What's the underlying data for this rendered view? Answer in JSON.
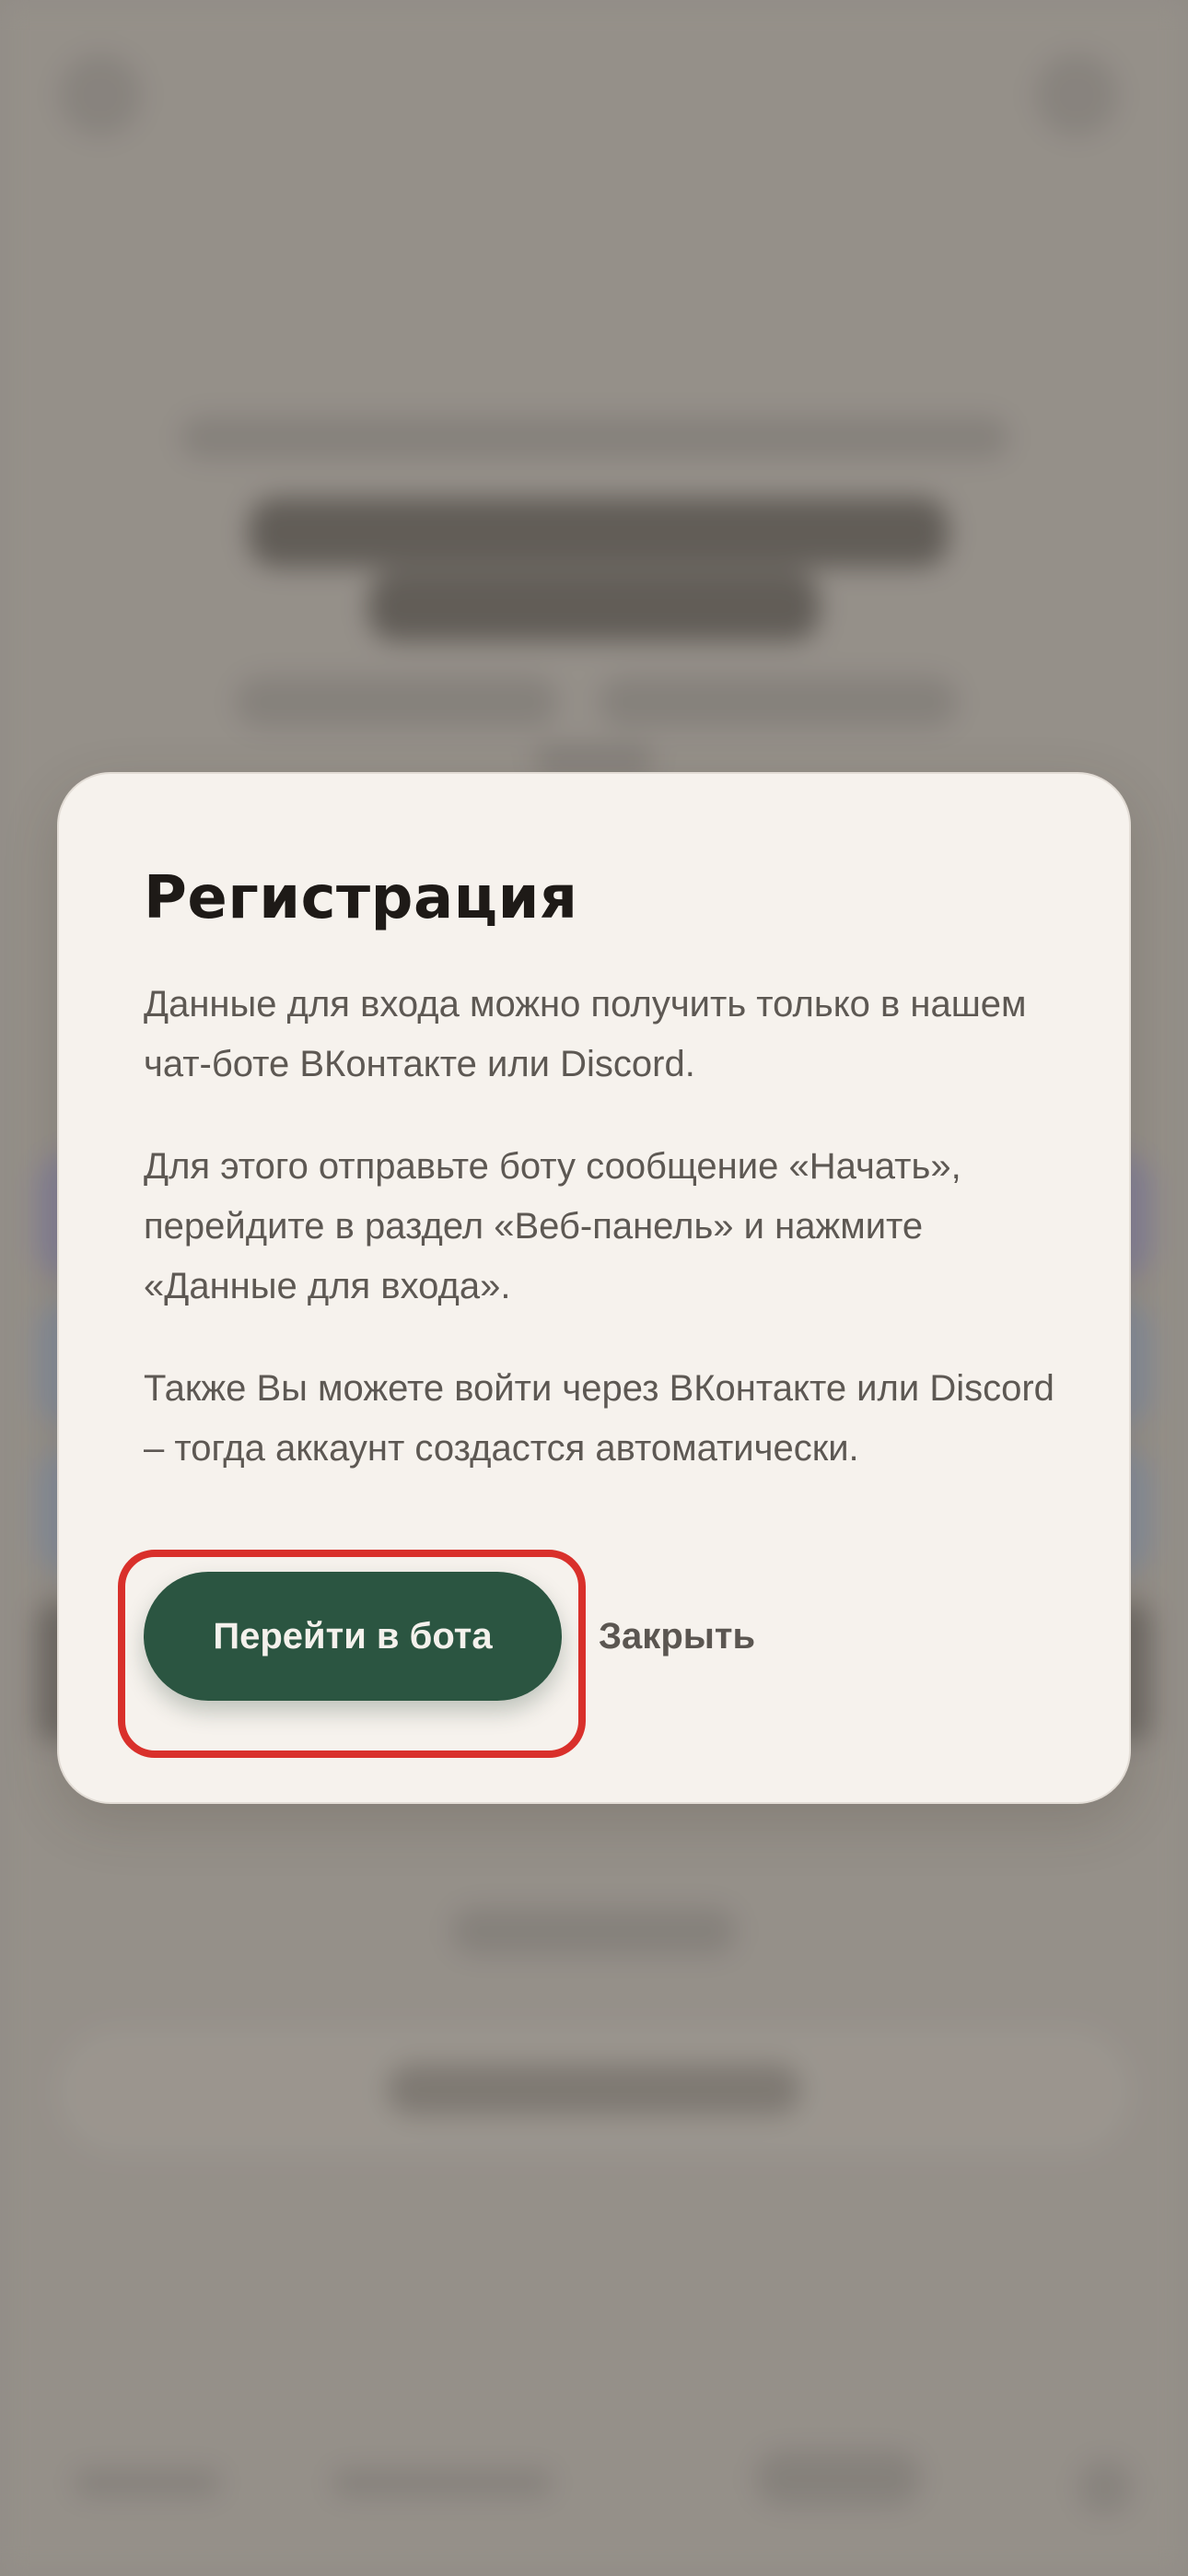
{
  "dialog": {
    "title": "Регистрация",
    "paragraphs": [
      "Данные для входа можно получить только в нашем чат-боте ВКонтакте или Discord.",
      "Для этого отправьте боту сообщение «Начать», перейдите в раздел «Веб-панель» и нажмите «Данные для входа».",
      "Также Вы можете войти через ВКонтакте или Discord – тогда аккаунт создастся автоматически."
    ],
    "primary_button": "Перейти в бота",
    "secondary_button": "Закрыть"
  },
  "colors": {
    "primary": "#2b5541",
    "highlight": "#d9302b",
    "dialog_bg": "#f6f2ed",
    "text": "#1e1a17"
  }
}
